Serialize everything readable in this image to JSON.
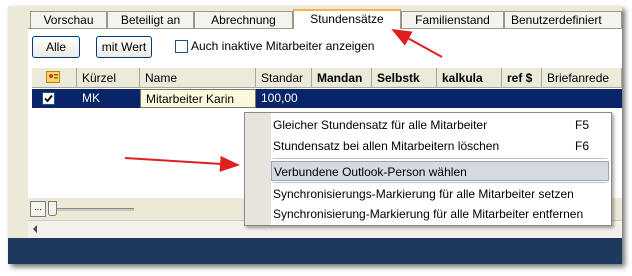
{
  "tabs": [
    {
      "label": "Vorschau",
      "active": false
    },
    {
      "label": "Beteiligt an",
      "active": false
    },
    {
      "label": "Abrechnung",
      "active": false
    },
    {
      "label": "Stundensätze",
      "active": true
    },
    {
      "label": "Familienstand",
      "active": false
    },
    {
      "label": "Benutzerdefiniert",
      "active": false
    }
  ],
  "toolbar": {
    "all_label": "Alle",
    "with_value_label": "mit Wert",
    "inactive_checkbox_label": "Auch inaktive Mitarbeiter anzeigen",
    "inactive_checked": false
  },
  "grid": {
    "columns": [
      "",
      "Kürzel",
      "Name",
      "Standar",
      "Mandan",
      "Selbstk",
      "kalkula",
      "ref $",
      "Briefanrede"
    ],
    "rows": [
      {
        "checked": true,
        "kuerzel": "MK",
        "name": "Mitarbeiter Karin",
        "standard": "100,00",
        "selected": true
      }
    ]
  },
  "context_menu": {
    "items": [
      {
        "label": "Gleicher Stundensatz für alle Mitarbeiter",
        "shortcut": "F5",
        "highlighted": false
      },
      {
        "label": "Stundensatz bei allen Mitarbeitern löschen",
        "shortcut": "F6",
        "highlighted": false
      },
      {
        "label": "Verbundene Outlook-Person wählen",
        "shortcut": "",
        "highlighted": true
      },
      {
        "label": "Synchronisierungs-Markierung für alle Mitarbeiter setzen",
        "shortcut": "",
        "highlighted": false
      },
      {
        "label": "Synchronisierung-Markierung für alle Mitarbeiter entfernen",
        "shortcut": "",
        "highlighted": false
      }
    ]
  },
  "bottom": {
    "ellipsis_label": "..."
  },
  "colors": {
    "selection": "#0a246a",
    "annotation_arrow": "#e02020",
    "active_tab_accent": "#f2b93c"
  }
}
